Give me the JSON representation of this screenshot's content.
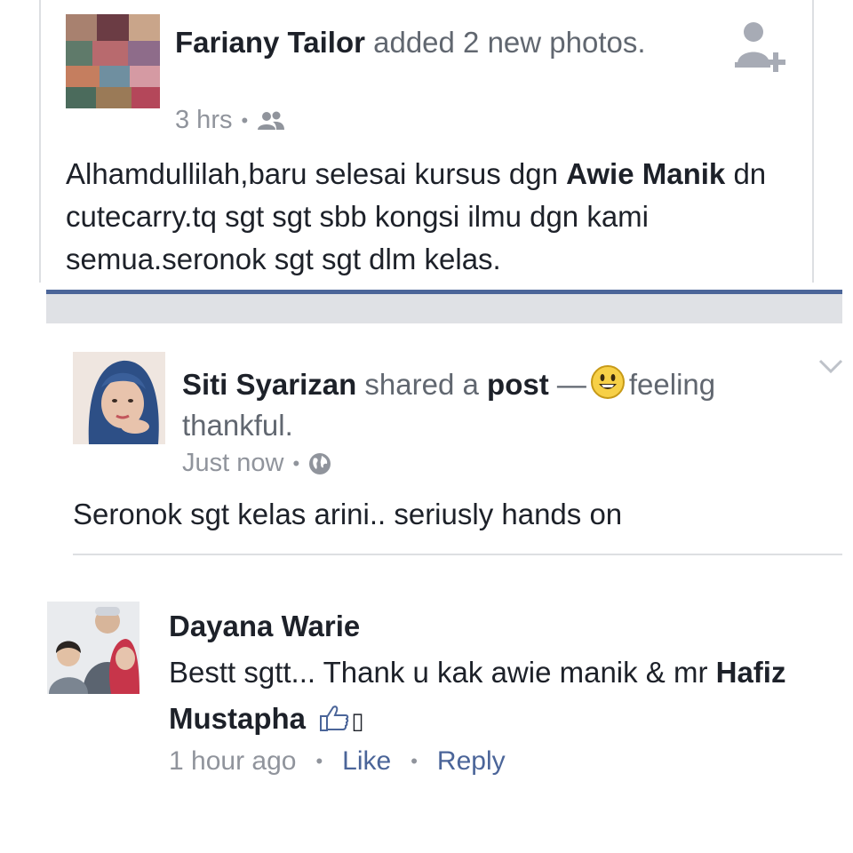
{
  "post1": {
    "author": "Fariany Tailor",
    "action": "added 2 new photos.",
    "time": "3 hrs",
    "audience_icon": "friends-icon",
    "body_before": "Alhamdullilah,baru selesai kursus dgn ",
    "tagged": "Awie Manik",
    "body_after": " dn cutecarry.tq sgt sgt sbb kongsi ilmu dgn kami semua.seronok sgt sgt dlm kelas."
  },
  "post2": {
    "author": "Siti Syarizan",
    "action": "shared a",
    "object": "post",
    "dash": "—",
    "feeling": "feeling thankful.",
    "time": "Just now",
    "audience_icon": "globe-icon",
    "body": "Seronok sgt kelas arini.. seriusly hands on"
  },
  "comment": {
    "author": "Dayana Warie",
    "text": "Bestt sgtt... Thank u kak awie manik & mr ",
    "tagged": "Hafiz Mustapha",
    "emoji": "👍",
    "trailing": "▯",
    "time": "1 hour ago",
    "like_label": "Like",
    "reply_label": "Reply"
  },
  "colors": {
    "link": "#4b6599",
    "meta": "#90949c",
    "divider_blue": "#4b6599"
  }
}
